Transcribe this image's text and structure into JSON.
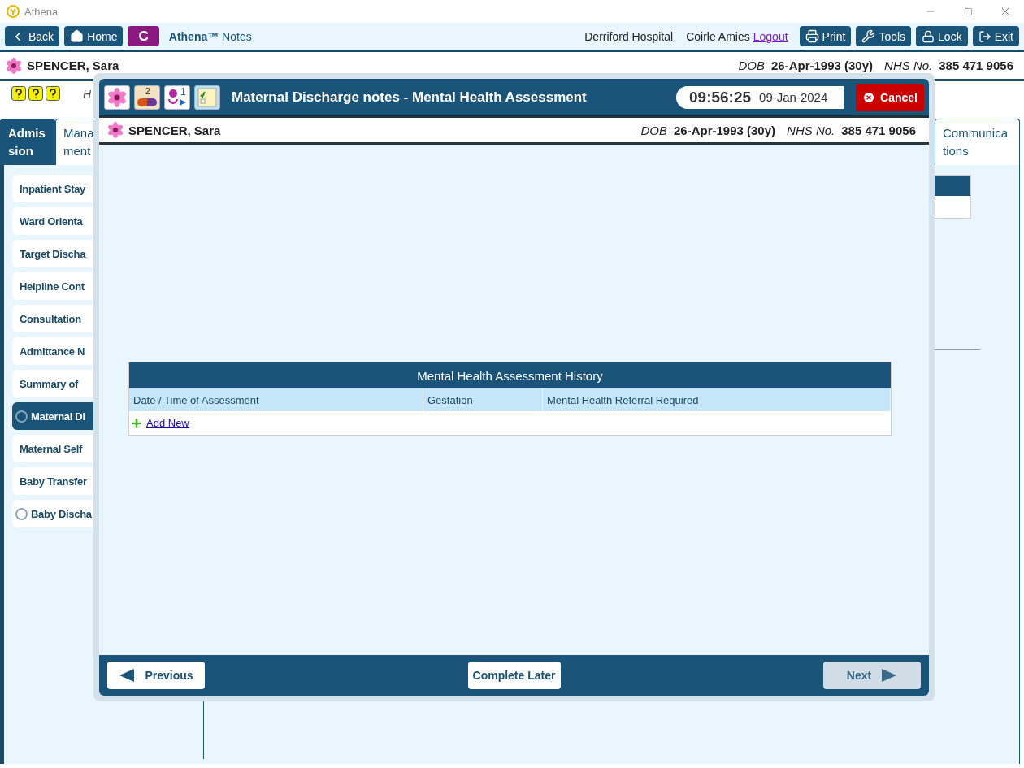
{
  "window": {
    "title": "Athena"
  },
  "toolbar": {
    "nav": [
      {
        "kind": "back",
        "label": "Back"
      },
      {
        "kind": "home",
        "label": "Home"
      },
      {
        "kind": "app",
        "label": "C"
      }
    ],
    "app_name": "Athena™",
    "app_suffix": "Notes",
    "hospital": "Derriford Hospital",
    "user": "Coirle Amies",
    "logout": "Logout",
    "actions": [
      {
        "kind": "print",
        "label": "Print"
      },
      {
        "kind": "tools",
        "label": "Tools"
      },
      {
        "kind": "lock",
        "label": "Lock"
      },
      {
        "kind": "exit",
        "label": "Exit"
      }
    ]
  },
  "patient": {
    "name": "SPENCER, Sara",
    "dob_label": "DOB",
    "dob": "26-Apr-1993 (30y)",
    "nhs_label": "NHS No.",
    "nhs": "385 471 9056"
  },
  "alerts": {
    "text": "H"
  },
  "tabs": [
    {
      "lines": [
        "Admis",
        "sion"
      ],
      "selected": true
    },
    {
      "lines": [
        "Mana",
        "ment"
      ],
      "selected": false
    },
    {
      "lines": [
        "Communica",
        "tions"
      ],
      "selected": false
    }
  ],
  "sidebar": {
    "items": [
      {
        "label": "Inpatient Stay",
        "kind": "plain",
        "selected": false
      },
      {
        "label": "Ward Orienta",
        "kind": "plain",
        "selected": false
      },
      {
        "label": "Target Discha",
        "kind": "plain",
        "selected": false
      },
      {
        "label": "Helpline Cont",
        "kind": "plain",
        "selected": false
      },
      {
        "label": "Consultation",
        "kind": "plain",
        "selected": false
      },
      {
        "label": "Admittance N",
        "kind": "plain",
        "selected": false
      },
      {
        "label": "Summary of",
        "kind": "plain",
        "selected": false
      },
      {
        "label": "Maternal Di",
        "kind": "radio",
        "selected": true
      },
      {
        "label": "Maternal Self",
        "kind": "plain",
        "selected": false
      },
      {
        "label": "Baby Transfer",
        "kind": "plain",
        "selected": false
      },
      {
        "label": "Baby Discha",
        "kind": "radio",
        "selected": false
      }
    ]
  },
  "modal": {
    "badges": [
      {
        "kind": "flower"
      },
      {
        "kind": "medication",
        "count": "2"
      },
      {
        "kind": "baby",
        "count": "1"
      },
      {
        "kind": "checklist"
      }
    ],
    "title": "Maternal Discharge notes - Mental Health Assessment",
    "time": "09:56:25",
    "date": "09-Jan-2024",
    "cancel": "Cancel",
    "patient": {
      "name": "SPENCER, Sara",
      "dob_label": "DOB",
      "dob": "26-Apr-1993 (30y)",
      "nhs_label": "NHS No.",
      "nhs": "385 471 9056"
    },
    "table": {
      "title": "Mental Health Assessment History",
      "columns": [
        "Date / Time of Assessment",
        "Gestation",
        "Mental Health Referral Required"
      ],
      "add_label": "Add New"
    },
    "footer": {
      "previous": "Previous",
      "complete": "Complete Later",
      "next": {
        "label": "Next",
        "disabled": true
      }
    }
  }
}
